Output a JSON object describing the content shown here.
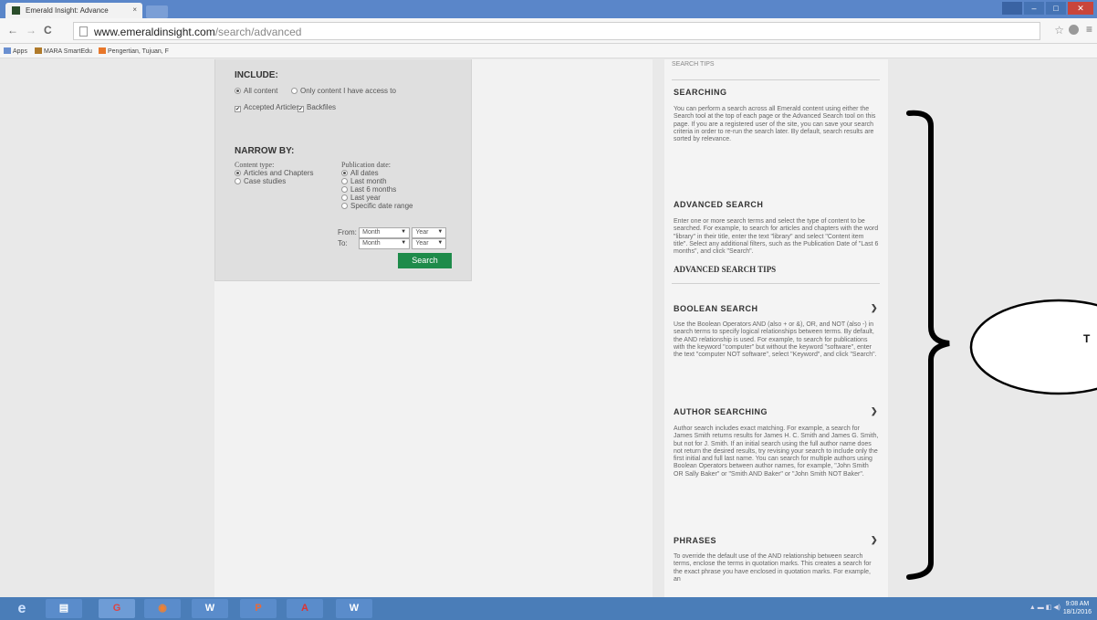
{
  "browser": {
    "tab_title": "Emerald Insight: Advance",
    "tab_close": "×",
    "url_host": "www.emeraldinsight.com",
    "url_path": "/search/advanced",
    "nav_back": "←",
    "nav_forward": "→",
    "nav_reload": "C",
    "star": "☆",
    "menu": "≡",
    "window": {
      "minimize": "–",
      "maximize": "□",
      "close": "✕"
    },
    "bookmarks": [
      "Apps",
      "MARA SmartEdu",
      "Pengertian, Tujuan, F"
    ]
  },
  "form": {
    "include_heading": "INCLUDE:",
    "access_options": [
      "All content",
      "Only content I have access to"
    ],
    "access_selected": 0,
    "checkboxes": [
      "Accepted Articles",
      "Backfiles"
    ],
    "narrow_heading": "NARROW BY:",
    "content_type_label": "Content type:",
    "content_types": [
      "Articles and Chapters",
      "Case studies"
    ],
    "pub_date_label": "Publication date:",
    "pub_dates": [
      "All dates",
      "Last month",
      "Last 6 months",
      "Last year",
      "Specific date range"
    ],
    "from_label": "From:",
    "to_label": "To:",
    "month_placeholder": "Month",
    "year_placeholder": "Year",
    "search_button": "Search"
  },
  "sidebar": {
    "top_cut_text": "SEARCH TIPS",
    "sections": [
      {
        "title": "SEARCHING",
        "text": "You can perform a search across all Emerald content using either the Search tool at the top of each page or the Advanced Search tool on this page. If you are a registered user of the site, you can save your search criteria in order to re-run the search later. By default, search results are sorted by relevance."
      },
      {
        "title": "ADVANCED SEARCH",
        "text": "Enter one or more search terms and select the type of content to be searched. For example, to search for articles and chapters with the word \"library\" in their title, enter the text \"library\" and select \"Content item title\". Select any additional filters, such as the Publication Date of \"Last 6 months\", and click \"Search\"."
      },
      {
        "title": "ADVANCED SEARCH TIPS",
        "text": ""
      },
      {
        "title": "BOOLEAN SEARCH",
        "text": "Use the Boolean Operators AND (also + or &), OR, and NOT (also -) in search terms to specify logical relationships between terms. By default, the AND relationship is used. For example, to search for publications with the keyword \"computer\" but without the keyword \"software\", enter the text \"computer NOT software\", select \"Keyword\", and click \"Search\"."
      },
      {
        "title": "AUTHOR SEARCHING",
        "text": "Author search includes exact matching. For example, a search for James Smith returns results for James H. C. Smith and James G. Smith, but not for J. Smith. If an initial search using the full author name does not return the desired results, try revising your search to include only the first initial and full last name. You can search for multiple authors using Boolean Operators between author names, for example, \"John Smith OR Sally Baker\" or \"Smith AND Baker\" or \"John Smith NOT Baker\"."
      },
      {
        "title": "PHRASES",
        "text": "To override the default use of the AND relationship between search terms, enclose the terms in quotation marks. This creates a search for the exact phrase you have enclosed in quotation marks. For example, an"
      }
    ]
  },
  "annotation": {
    "letter": "T"
  },
  "taskbar": {
    "items": [
      "e",
      "▤",
      "G",
      "◉",
      "W",
      "P",
      "A",
      "W"
    ],
    "clock_time": "9:08 AM",
    "clock_date": "18/1/2016"
  }
}
